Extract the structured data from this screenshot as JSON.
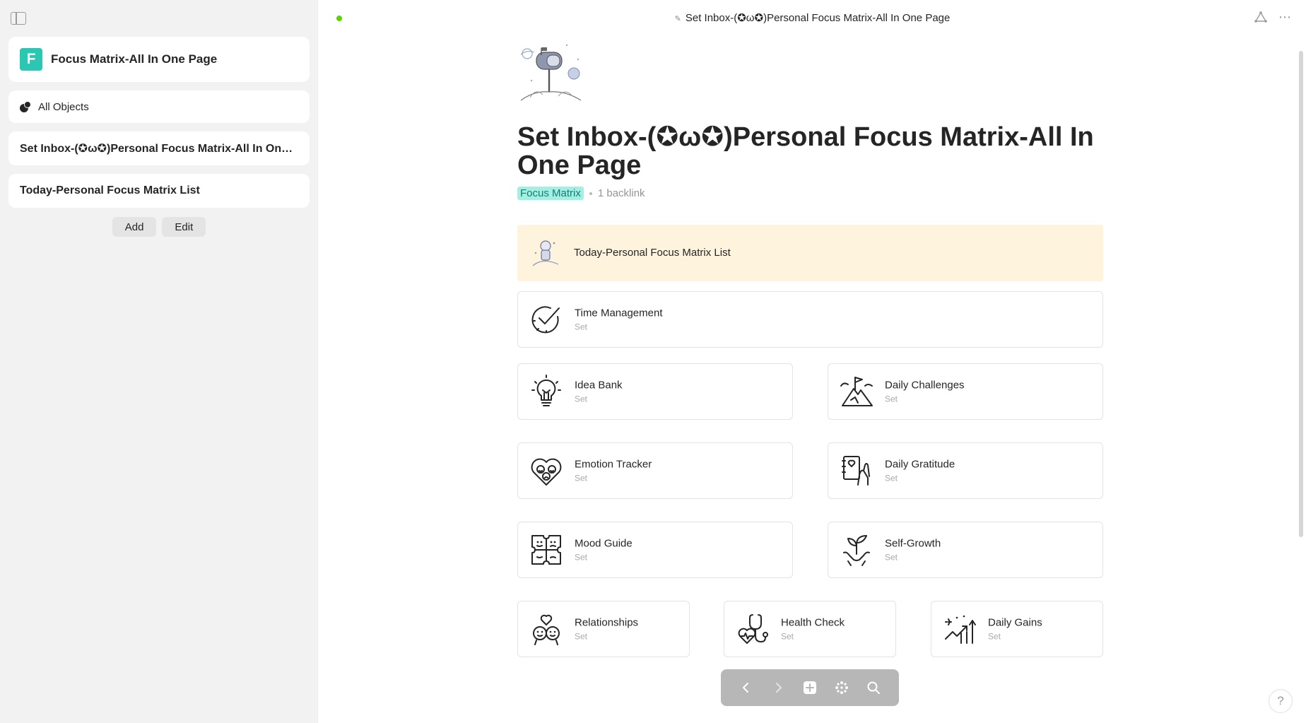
{
  "sidebar": {
    "space_logo_letter": "F",
    "space_name": "Focus Matrix-All In One Page",
    "all_objects_label": "All Objects",
    "widgets": [
      {
        "label": "Set Inbox-(✪ω✪)Personal Focus Matrix-All In One Page"
      },
      {
        "label": "Today-Personal Focus Matrix List"
      }
    ],
    "add_label": "Add",
    "edit_label": "Edit"
  },
  "header": {
    "breadcrumb": "Set Inbox-(✪ω✪)Personal Focus Matrix-All In One Page",
    "sync_color": "#5dd400"
  },
  "page": {
    "title": "Set Inbox-(✪ω✪)Personal Focus Matrix-All In One Page",
    "tag": "Focus Matrix",
    "backlinks": "1 backlink"
  },
  "featured": {
    "name": "Today-Personal Focus Matrix List",
    "bg": "#fef3dc"
  },
  "cards": {
    "time": {
      "name": "Time Management",
      "type": "Set",
      "icon": "clock-check-icon"
    },
    "idea": {
      "name": "Idea Bank",
      "type": "Set",
      "icon": "lightbulb-icon"
    },
    "challenges": {
      "name": "Daily Challenges",
      "type": "Set",
      "icon": "mountain-flag-icon"
    },
    "emotion": {
      "name": "Emotion Tracker",
      "type": "Set",
      "icon": "heart-faces-icon"
    },
    "gratitude": {
      "name": "Daily Gratitude",
      "type": "Set",
      "icon": "notebook-hands-icon"
    },
    "mood": {
      "name": "Mood Guide",
      "type": "Set",
      "icon": "puzzle-faces-icon"
    },
    "self_growth": {
      "name": "Self-Growth",
      "type": "Set",
      "icon": "hand-sprout-icon"
    },
    "relationships": {
      "name": "Relationships",
      "type": "Set",
      "icon": "couple-heart-icon"
    },
    "health": {
      "name": "Health Check",
      "type": "Set",
      "icon": "stethoscope-icon"
    },
    "gains": {
      "name": "Daily Gains",
      "type": "Set",
      "icon": "growth-chart-icon"
    }
  },
  "help_label": "?"
}
